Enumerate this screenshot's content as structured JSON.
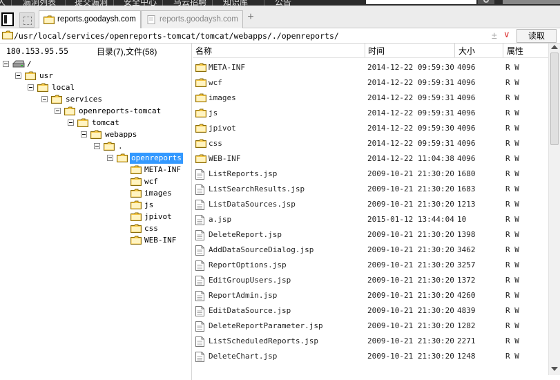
{
  "top_menu": {
    "items": [
      "漏洞列表",
      "提交漏洞",
      "安全中心",
      "乌云招聘",
      "知识库",
      "公告"
    ]
  },
  "tabs": [
    {
      "label": "reports.goodaysh.com",
      "active": true
    },
    {
      "label": "reports.goodaysh.com",
      "active": false
    }
  ],
  "address": {
    "path": "/usr/local/services/openreports-tomcat/tomcat/webapps/./openreports/",
    "read_label": "读取"
  },
  "left": {
    "ip": "180.153.95.55",
    "count": "目录(7),文件(58)",
    "tree": [
      {
        "label": "/",
        "icon": "drive-icon"
      },
      {
        "label": "usr",
        "icon": "folder-icon"
      },
      {
        "label": "local",
        "icon": "folder-icon"
      },
      {
        "label": "services",
        "icon": "folder-icon"
      },
      {
        "label": "openreports-tomcat",
        "icon": "folder-icon"
      },
      {
        "label": "tomcat",
        "icon": "folder-icon"
      },
      {
        "label": "webapps",
        "icon": "folder-icon"
      },
      {
        "label": ".",
        "icon": "folder-icon"
      },
      {
        "label": "openreports",
        "icon": "folder-icon",
        "selected": true
      }
    ],
    "children": [
      "META-INF",
      "wcf",
      "images",
      "js",
      "jpivot",
      "css",
      "WEB-INF"
    ]
  },
  "list": {
    "headers": {
      "name": "名称",
      "time": "时间",
      "size": "大小",
      "attr": "属性"
    },
    "rows": [
      {
        "name": "META-INF",
        "time": "2014-12-22 09:59:30",
        "size": "4096",
        "attr": "R W",
        "type": "folder"
      },
      {
        "name": "wcf",
        "time": "2014-12-22 09:59:31",
        "size": "4096",
        "attr": "R W",
        "type": "folder"
      },
      {
        "name": "images",
        "time": "2014-12-22 09:59:31",
        "size": "4096",
        "attr": "R W",
        "type": "folder"
      },
      {
        "name": "js",
        "time": "2014-12-22 09:59:31",
        "size": "4096",
        "attr": "R W",
        "type": "folder"
      },
      {
        "name": "jpivot",
        "time": "2014-12-22 09:59:30",
        "size": "4096",
        "attr": "R W",
        "type": "folder"
      },
      {
        "name": "css",
        "time": "2014-12-22 09:59:31",
        "size": "4096",
        "attr": "R W",
        "type": "folder"
      },
      {
        "name": "WEB-INF",
        "time": "2014-12-22 11:04:38",
        "size": "4096",
        "attr": "R W",
        "type": "folder"
      },
      {
        "name": "ListReports.jsp",
        "time": "2009-10-21 21:30:20",
        "size": "1680",
        "attr": "R W",
        "type": "file"
      },
      {
        "name": "ListSearchResults.jsp",
        "time": "2009-10-21 21:30:20",
        "size": "1683",
        "attr": "R W",
        "type": "file"
      },
      {
        "name": "ListDataSources.jsp",
        "time": "2009-10-21 21:30:20",
        "size": "1213",
        "attr": "R W",
        "type": "file"
      },
      {
        "name": "a.jsp",
        "time": "2015-01-12 13:44:04",
        "size": "10",
        "attr": "R W",
        "type": "file"
      },
      {
        "name": "DeleteReport.jsp",
        "time": "2009-10-21 21:30:20",
        "size": "1398",
        "attr": "R W",
        "type": "file"
      },
      {
        "name": "AddDataSourceDialog.jsp",
        "time": "2009-10-21 21:30:20",
        "size": "3462",
        "attr": "R W",
        "type": "file"
      },
      {
        "name": "ReportOptions.jsp",
        "time": "2009-10-21 21:30:20",
        "size": "3257",
        "attr": "R W",
        "type": "file"
      },
      {
        "name": "EditGroupUsers.jsp",
        "time": "2009-10-21 21:30:20",
        "size": "1372",
        "attr": "R W",
        "type": "file"
      },
      {
        "name": "ReportAdmin.jsp",
        "time": "2009-10-21 21:30:20",
        "size": "4260",
        "attr": "R W",
        "type": "file"
      },
      {
        "name": "EditDataSource.jsp",
        "time": "2009-10-21 21:30:20",
        "size": "4839",
        "attr": "R W",
        "type": "file"
      },
      {
        "name": "DeleteReportParameter.jsp",
        "time": "2009-10-21 21:30:20",
        "size": "1282",
        "attr": "R W",
        "type": "file"
      },
      {
        "name": "ListScheduledReports.jsp",
        "time": "2009-10-21 21:30:20",
        "size": "2271",
        "attr": "R W",
        "type": "file"
      },
      {
        "name": "DeleteChart.jsp",
        "time": "2009-10-21 21:30:20",
        "size": "1248",
        "attr": "R W",
        "type": "file"
      }
    ]
  },
  "colors": {
    "folder": "#f4c542",
    "selection": "#3399ff",
    "chevron": "#dd3333"
  }
}
